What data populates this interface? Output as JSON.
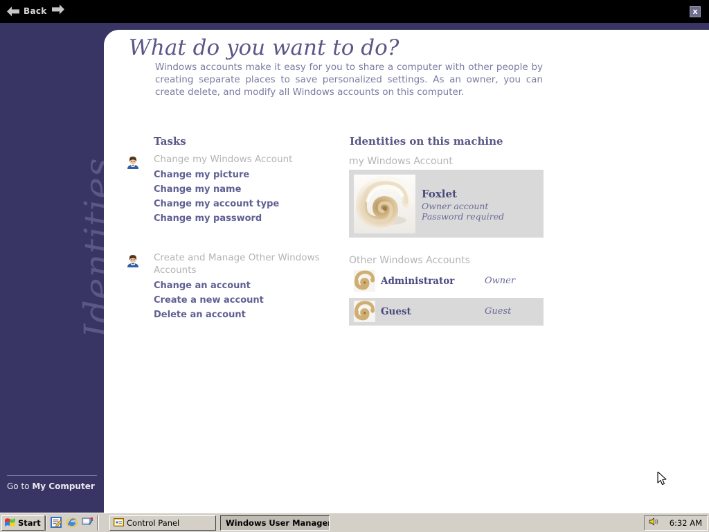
{
  "navbar": {
    "back_label": "Back",
    "back_icon": "arrow-left-icon",
    "forward_icon": "arrow-right-icon",
    "close_label": "x"
  },
  "sidebar": {
    "vertical_title": "Identities",
    "goto_prefix": "Go to ",
    "goto_target": "My Computer"
  },
  "content": {
    "heading": "What do you want to do?",
    "intro": "Windows accounts make it easy for you to share a computer with other people by creating separate places to save personalized settings. As an owner, you can create delete, and modify all Windows accounts on this computer.",
    "tasks_heading": "Tasks",
    "identities_heading": "Identities on this machine"
  },
  "tasks": [
    {
      "icon": "user-avatar-icon",
      "group_title": "Change my Windows Account",
      "links": [
        "Change my picture",
        "Change my name",
        "Change my account type",
        "Change my password"
      ]
    },
    {
      "icon": "user-avatar-icon",
      "group_title": "Create and Manage Other Windows Accounts",
      "links": [
        "Change an account",
        "Create a new account",
        "Delete an account"
      ]
    }
  ],
  "identities": {
    "owner_section_label": "my Windows Account",
    "owner": {
      "name": "Foxlet",
      "account_type": "Owner account",
      "password_status": "Password required",
      "picture": "nautilus-shell-picture"
    },
    "others_section_label": "Other Windows Accounts",
    "others": [
      {
        "name": "Administrator",
        "role": "Owner",
        "picture": "nautilus-shell-picture",
        "selected": false
      },
      {
        "name": "Guest",
        "role": "Guest",
        "picture": "nautilus-shell-picture",
        "selected": true
      }
    ]
  },
  "taskbar": {
    "start_label": "Start",
    "quick_launch": [
      {
        "name": "notepad-icon"
      },
      {
        "name": "internet-explorer-icon"
      },
      {
        "name": "show-desktop-icon"
      }
    ],
    "task_buttons": [
      {
        "label": "Control Panel",
        "icon": "control-panel-icon",
        "active": false
      },
      {
        "label": "Windows User Manager",
        "icon": "user-manager-icon",
        "active": true
      }
    ],
    "tray": {
      "volume_icon": "speaker-icon",
      "time": "6:32 AM"
    }
  },
  "colors": {
    "sidebar_purple": "#383463",
    "heading_purple": "#5a5786",
    "link_purple": "#5f5f93",
    "muted_gray": "#b4b4b4",
    "card_gray": "#d9d9d9",
    "taskbar_gray": "#d4d0c8"
  }
}
